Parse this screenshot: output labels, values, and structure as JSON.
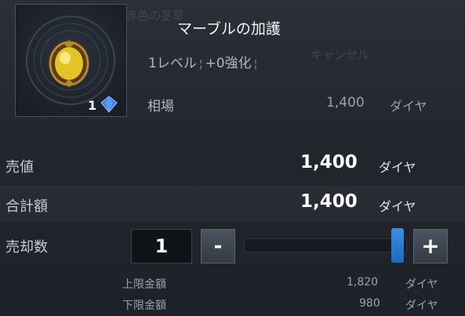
{
  "background_text": {
    "left": "赤色の茎草",
    "cancel": "キャンセル"
  },
  "item": {
    "name": "マーブルの加護",
    "level": "1レベル",
    "enhance": "+0強化",
    "count": "1",
    "gem_icon": "diamond-icon"
  },
  "market": {
    "label": "相場",
    "value": "1,400",
    "unit": "ダイヤ"
  },
  "sale_price": {
    "label": "売値",
    "value": "1,400",
    "unit": "ダイヤ"
  },
  "total": {
    "label": "合計額",
    "value": "1,400",
    "unit": "ダイヤ"
  },
  "sell_qty": {
    "label": "売却数",
    "value": "1",
    "minus": "-",
    "plus": "+",
    "slider_fraction": 1.0
  },
  "limits": {
    "upper_label": "上限金額",
    "upper_value": "1,820",
    "lower_label": "下限金額",
    "lower_value": "980",
    "unit": "ダイヤ"
  },
  "colors": {
    "accent": "#2a7bd6",
    "background": "#22262d"
  }
}
